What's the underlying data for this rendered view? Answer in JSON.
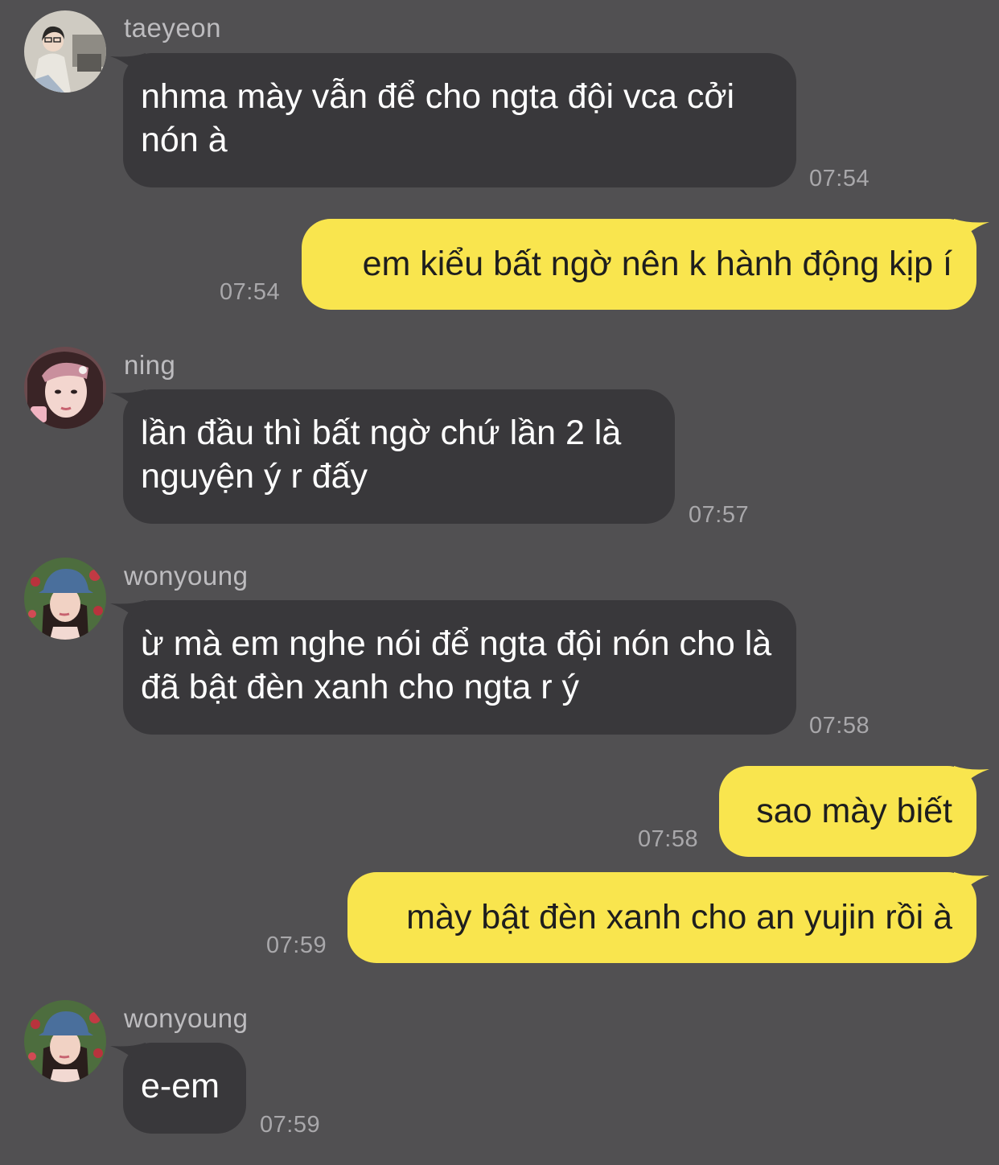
{
  "messages": [
    {
      "sender": "taeyeon",
      "avatar_icon": "avatar-taeyeon-icon",
      "text": "nhma mày vẫn để cho ngta đội vca cởi nón à",
      "time": "07:54"
    },
    {
      "text": "em kiểu bất ngờ nên k hành động kịp í",
      "time": "07:54"
    },
    {
      "sender": "ning",
      "avatar_icon": "avatar-ning-icon",
      "text": "lần đầu thì bất ngờ chứ lần 2 là nguyện ý r đấy",
      "time": "07:57"
    },
    {
      "sender": "wonyoung",
      "avatar_icon": "avatar-wonyoung-icon",
      "text": "ừ mà em nghe nói để ngta đội nón cho là đã bật đèn xanh cho ngta r ý",
      "time": "07:58"
    },
    {
      "text": "sao mày biết",
      "time": "07:58"
    },
    {
      "text": "mày bật đèn xanh cho an yujin rồi à",
      "time": "07:59"
    },
    {
      "sender": "wonyoung",
      "avatar_icon": "avatar-wonyoung-icon",
      "text": "e-em",
      "time": "07:59"
    }
  ],
  "colors": {
    "background": "#515052",
    "incoming_bubble": "#39383b",
    "outgoing_bubble": "#f9e54e",
    "incoming_text": "#ffffff",
    "outgoing_text": "#1e1e1e",
    "timestamp": "#a9a8ab",
    "sender_name": "#bdbcbf"
  }
}
